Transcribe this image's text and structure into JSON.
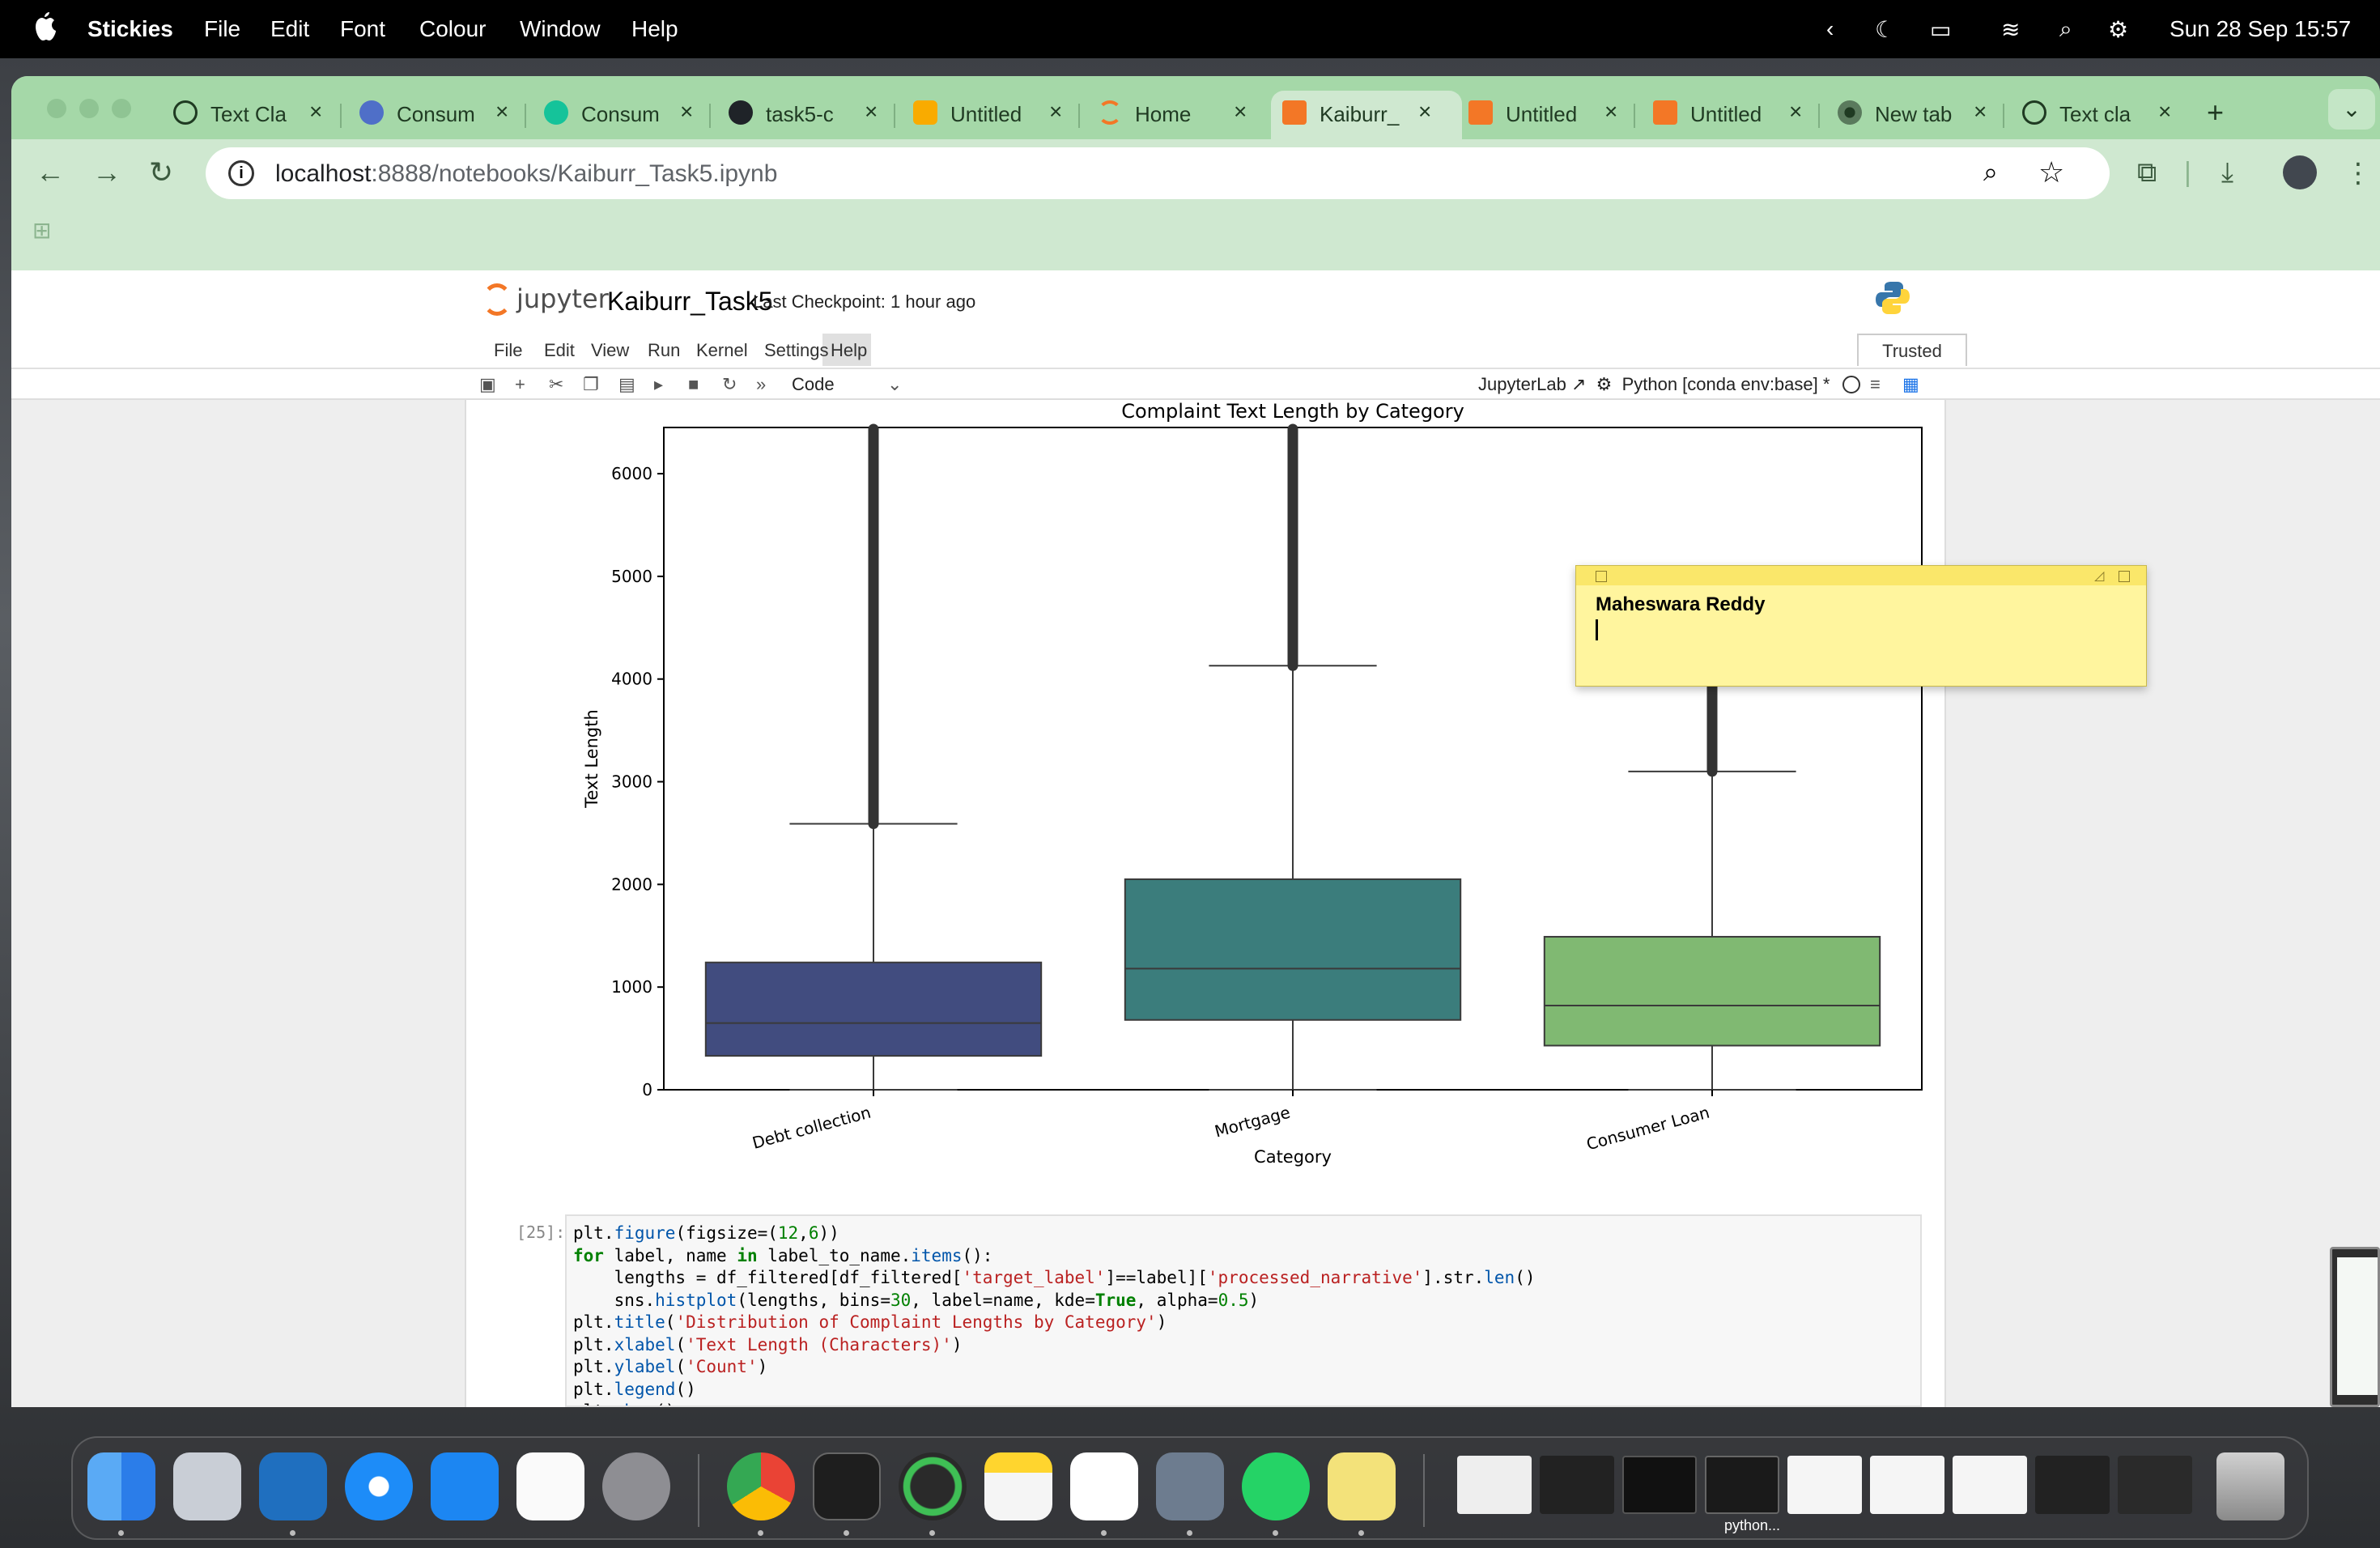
{
  "menubar": {
    "app_name": "Stickies",
    "items": [
      "File",
      "Edit",
      "Font",
      "Colour",
      "Window",
      "Help"
    ],
    "clock": "Sun 28 Sep  15:57"
  },
  "browser": {
    "tabs": [
      {
        "label": "Text Cla",
        "icon": "chatgpt-icon",
        "active": false
      },
      {
        "label": "Consum",
        "icon": "dictionary-icon",
        "active": false
      },
      {
        "label": "Consum",
        "icon": "grammarly-icon",
        "active": false
      },
      {
        "label": "task5-c",
        "icon": "github-icon",
        "active": false
      },
      {
        "label": "Untitled",
        "icon": "colab-icon",
        "active": false
      },
      {
        "label": "Home",
        "icon": "jupyter-icon",
        "active": false
      },
      {
        "label": "Kaiburr_",
        "icon": "jupyter-notebook-icon",
        "active": true
      },
      {
        "label": "Untitled",
        "icon": "jupyter-notebook-icon",
        "active": false
      },
      {
        "label": "Untitled",
        "icon": "jupyter-notebook-icon",
        "active": false
      },
      {
        "label": "New tab",
        "icon": "chrome-icon",
        "active": false
      },
      {
        "label": "Text cla",
        "icon": "chatgpt-icon",
        "active": false
      }
    ],
    "url_host": "localhost",
    "url_path": ":8888/notebooks/Kaiburr_Task5.ipynb"
  },
  "jupyter": {
    "logo_text": "jupyter",
    "notebook_name": "Kaiburr_Task5",
    "checkpoint": "Last Checkpoint: 1 hour ago",
    "menu": [
      "File",
      "Edit",
      "View",
      "Run",
      "Kernel",
      "Settings",
      "Help"
    ],
    "trusted": "Trusted",
    "cell_type": "Code",
    "jupyterlab_link": "JupyterLab",
    "kernel": "Python [conda env:base] *",
    "cell_prompt": "[25]:",
    "code_lines": [
      "plt.figure(figsize=(12,6))",
      "for label, name in label_to_name.items():",
      "    lengths = df_filtered[df_filtered['target_label']==label]['processed_narrative'].str.len()",
      "    sns.histplot(lengths, bins=30, label=name, kde=True, alpha=0.5)",
      "plt.title('Distribution of Complaint Lengths by Category')",
      "plt.xlabel('Text Length (Characters)')",
      "plt.ylabel('Count')",
      "plt.legend()",
      "plt.show()"
    ]
  },
  "chart_data": {
    "type": "box",
    "title": "Complaint Text Length by Category",
    "xlabel": "Category",
    "ylabel": "Text Length",
    "ylim": [
      0,
      6450
    ],
    "yticks": [
      0,
      1000,
      2000,
      3000,
      4000,
      5000,
      6000
    ],
    "categories": [
      "Debt collection",
      "Mortgage",
      "Consumer Loan"
    ],
    "boxes": [
      {
        "category": "Debt collection",
        "min": 0,
        "q1": 330,
        "median": 650,
        "q3": 1240,
        "whisker_high": 2590,
        "outliers_from": 2590,
        "outliers_to": 6450,
        "color": "#414c7f"
      },
      {
        "category": "Mortgage",
        "min": 0,
        "q1": 680,
        "median": 1180,
        "q3": 2050,
        "whisker_high": 4130,
        "outliers_from": 4130,
        "outliers_to": 6450,
        "color": "#3b7d7c"
      },
      {
        "category": "Consumer Loan",
        "min": 0,
        "q1": 430,
        "median": 820,
        "q3": 1490,
        "whisker_high": 3100,
        "outliers_from": 3100,
        "outliers_to": 4700,
        "color": "#80b972"
      }
    ]
  },
  "sticky": {
    "text": "Maheswara Reddy"
  },
  "dock": {
    "label": "python..."
  }
}
